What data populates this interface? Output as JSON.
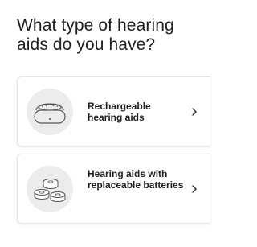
{
  "page": {
    "title": "What type of hearing aids do you have?"
  },
  "options": [
    {
      "label": "Rechargeable hearing aids",
      "image_icon": "charging-case-icon",
      "chevron_icon": "chevron-right-icon"
    },
    {
      "label": "Hearing aids with replaceable batteries",
      "image_icon": "batteries-icon",
      "chevron_icon": "chevron-right-icon"
    }
  ],
  "colors": {
    "text": "#1f1f1f",
    "card_border": "#e4e4e4",
    "image_bg": "#ececec",
    "icon_stroke": "#555555"
  }
}
